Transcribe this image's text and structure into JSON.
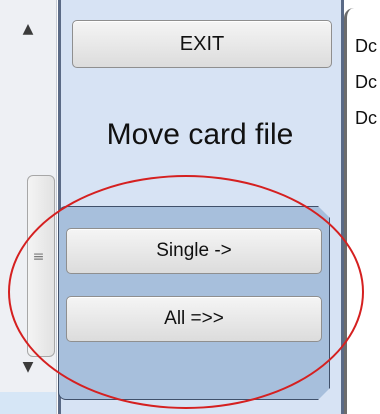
{
  "panel": {
    "exit_label": "EXIT",
    "title": "Move card file",
    "single_label": "Single ->",
    "all_label": "All =>>"
  },
  "scrollbar": {
    "up_arrow": "▲",
    "down_arrow": "▼",
    "grip": "≡"
  },
  "list": {
    "items": [
      "Dc",
      "Dc",
      "Dc"
    ]
  },
  "annotation": {
    "color": "#d52020"
  },
  "colors": {
    "panel_bg": "#d7e3f4",
    "lower_box_bg": "#a7bfdc"
  }
}
